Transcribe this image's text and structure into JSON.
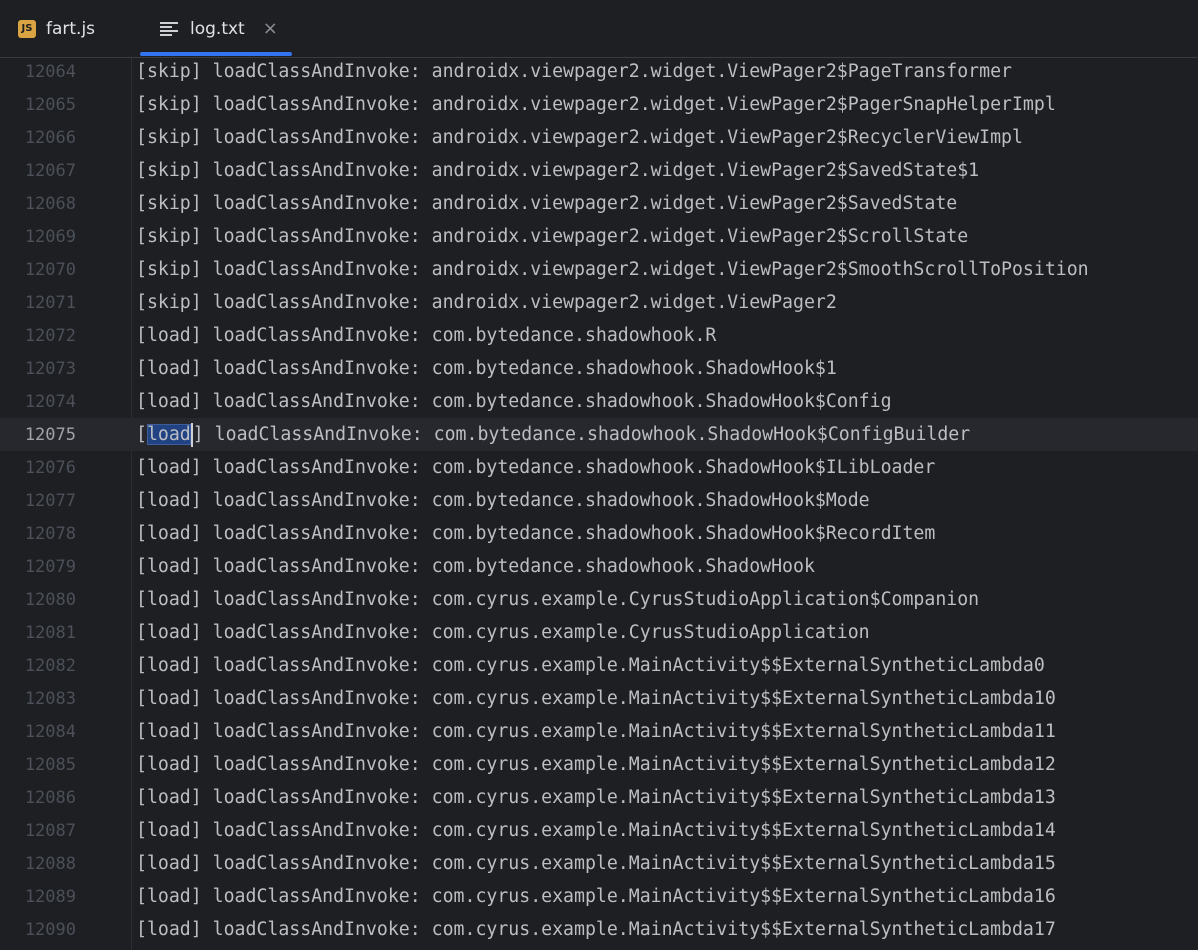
{
  "tabs": [
    {
      "label": "fart.js",
      "icon": "js-file-icon",
      "icon_text": "JS",
      "active": false
    },
    {
      "label": "log.txt",
      "icon": "text-file-icon",
      "active": true,
      "close": "×"
    }
  ],
  "editor": {
    "current_line": "12075",
    "lines": [
      {
        "num": "12064",
        "text": "[skip] loadClassAndInvoke: androidx.viewpager2.widget.ViewPager2$PageTransformer"
      },
      {
        "num": "12065",
        "text": "[skip] loadClassAndInvoke: androidx.viewpager2.widget.ViewPager2$PagerSnapHelperImpl"
      },
      {
        "num": "12066",
        "text": "[skip] loadClassAndInvoke: androidx.viewpager2.widget.ViewPager2$RecyclerViewImpl"
      },
      {
        "num": "12067",
        "text": "[skip] loadClassAndInvoke: androidx.viewpager2.widget.ViewPager2$SavedState$1"
      },
      {
        "num": "12068",
        "text": "[skip] loadClassAndInvoke: androidx.viewpager2.widget.ViewPager2$SavedState"
      },
      {
        "num": "12069",
        "text": "[skip] loadClassAndInvoke: androidx.viewpager2.widget.ViewPager2$ScrollState"
      },
      {
        "num": "12070",
        "text": "[skip] loadClassAndInvoke: androidx.viewpager2.widget.ViewPager2$SmoothScrollToPosition"
      },
      {
        "num": "12071",
        "text": "[skip] loadClassAndInvoke: androidx.viewpager2.widget.ViewPager2"
      },
      {
        "num": "12072",
        "text": "[load] loadClassAndInvoke: com.bytedance.shadowhook.R"
      },
      {
        "num": "12073",
        "text": "[load] loadClassAndInvoke: com.bytedance.shadowhook.ShadowHook$1"
      },
      {
        "num": "12074",
        "text": "[load] loadClassAndInvoke: com.bytedance.shadowhook.ShadowHook$Config"
      },
      {
        "num": "12075",
        "pre": "[",
        "selected": "load",
        "post": "] loadClassAndInvoke: com.bytedance.shadowhook.ShadowHook$ConfigBuilder"
      },
      {
        "num": "12076",
        "text": "[load] loadClassAndInvoke: com.bytedance.shadowhook.ShadowHook$ILibLoader"
      },
      {
        "num": "12077",
        "text": "[load] loadClassAndInvoke: com.bytedance.shadowhook.ShadowHook$Mode"
      },
      {
        "num": "12078",
        "text": "[load] loadClassAndInvoke: com.bytedance.shadowhook.ShadowHook$RecordItem"
      },
      {
        "num": "12079",
        "text": "[load] loadClassAndInvoke: com.bytedance.shadowhook.ShadowHook"
      },
      {
        "num": "12080",
        "text": "[load] loadClassAndInvoke: com.cyrus.example.CyrusStudioApplication$Companion"
      },
      {
        "num": "12081",
        "text": "[load] loadClassAndInvoke: com.cyrus.example.CyrusStudioApplication"
      },
      {
        "num": "12082",
        "text": "[load] loadClassAndInvoke: com.cyrus.example.MainActivity$$ExternalSyntheticLambda0"
      },
      {
        "num": "12083",
        "text": "[load] loadClassAndInvoke: com.cyrus.example.MainActivity$$ExternalSyntheticLambda10"
      },
      {
        "num": "12084",
        "text": "[load] loadClassAndInvoke: com.cyrus.example.MainActivity$$ExternalSyntheticLambda11"
      },
      {
        "num": "12085",
        "text": "[load] loadClassAndInvoke: com.cyrus.example.MainActivity$$ExternalSyntheticLambda12"
      },
      {
        "num": "12086",
        "text": "[load] loadClassAndInvoke: com.cyrus.example.MainActivity$$ExternalSyntheticLambda13"
      },
      {
        "num": "12087",
        "text": "[load] loadClassAndInvoke: com.cyrus.example.MainActivity$$ExternalSyntheticLambda14"
      },
      {
        "num": "12088",
        "text": "[load] loadClassAndInvoke: com.cyrus.example.MainActivity$$ExternalSyntheticLambda15"
      },
      {
        "num": "12089",
        "text": "[load] loadClassAndInvoke: com.cyrus.example.MainActivity$$ExternalSyntheticLambda16"
      },
      {
        "num": "12090",
        "text": "[load] loadClassAndInvoke: com.cyrus.example.MainActivity$$ExternalSyntheticLambda17"
      }
    ]
  },
  "colors": {
    "background": "#1e1f22",
    "text": "#bcbec4",
    "line_number": "#4b5059",
    "active_tab_underline": "#3574f0",
    "selection": "#214283",
    "js_icon": "#d9a441"
  }
}
